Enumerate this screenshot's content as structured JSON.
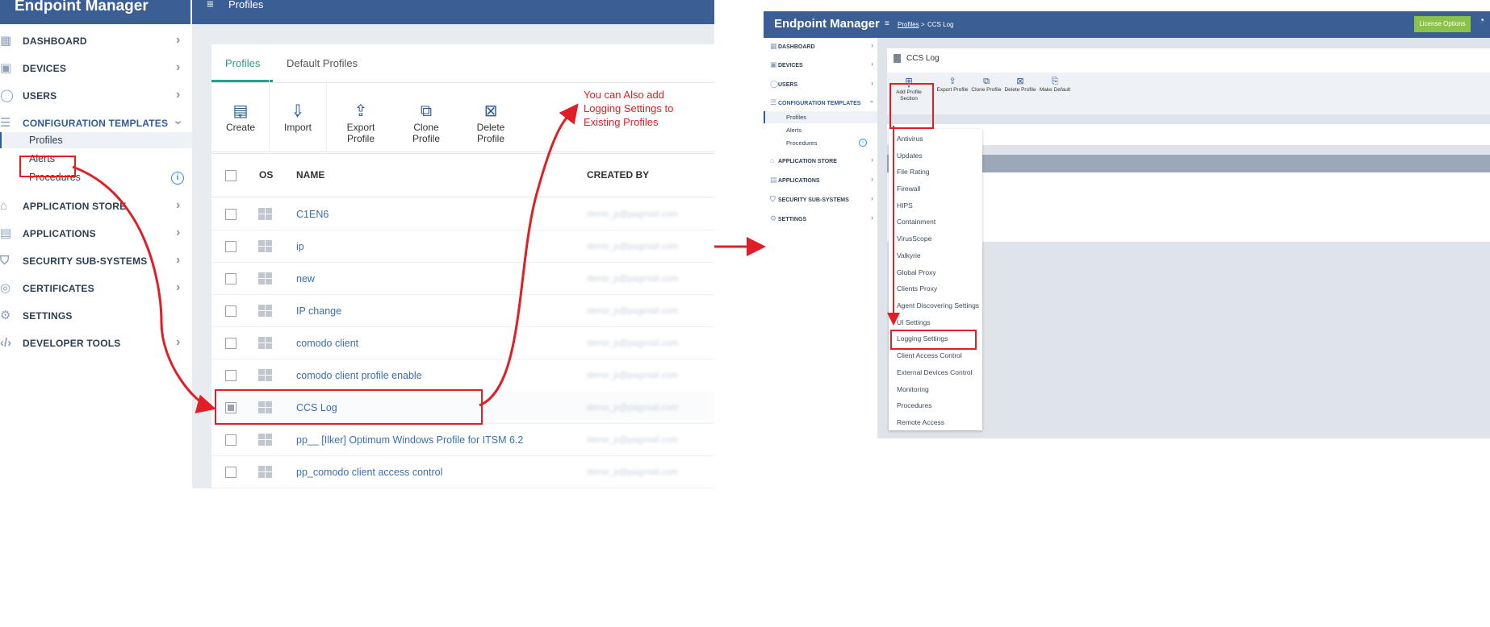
{
  "left": {
    "brand": "Endpoint Manager",
    "topbar_title": "Profiles",
    "sidebar": [
      {
        "label": "DASHBOARD",
        "icon": "dashboard-icon"
      },
      {
        "label": "DEVICES",
        "icon": "devices-icon"
      },
      {
        "label": "USERS",
        "icon": "user-icon"
      },
      {
        "label": "CONFIGURATION TEMPLATES",
        "icon": "templates-icon"
      },
      {
        "label": "APPLICATION STORE",
        "icon": "store-icon"
      },
      {
        "label": "APPLICATIONS",
        "icon": "apps-icon"
      },
      {
        "label": "SECURITY SUB-SYSTEMS",
        "icon": "shield-icon"
      },
      {
        "label": "CERTIFICATES",
        "icon": "certificate-icon"
      },
      {
        "label": "SETTINGS",
        "icon": "gear-icon"
      },
      {
        "label": "DEVELOPER TOOLS",
        "icon": "code-icon"
      }
    ],
    "submenu": [
      "Profiles",
      "Alerts",
      "Procedures"
    ],
    "tabs": [
      "Profiles",
      "Default Profiles"
    ],
    "toolbar": [
      "Create",
      "Import",
      "Export Profile",
      "Clone Profile",
      "Delete Profile"
    ],
    "columns": [
      "OS",
      "NAME",
      "CREATED BY"
    ],
    "rows": [
      {
        "name": "C1EN6",
        "created_by": "demo_p@pagmail.com"
      },
      {
        "name": "ip",
        "created_by": "demo_p@pagmail.com"
      },
      {
        "name": "new",
        "created_by": "demo_p@pagmail.com"
      },
      {
        "name": "IP change",
        "created_by": "demo_p@pagmail.com"
      },
      {
        "name": "comodo client",
        "created_by": "demo_p@pagmail.com"
      },
      {
        "name": "comodo client profile enable",
        "created_by": "demo_p@pagmail.com"
      },
      {
        "name": "CCS Log",
        "created_by": "demo_p@pagmail.com"
      },
      {
        "name": "pp__ [Ilker] Optimum Windows Profile for ITSM 6.2",
        "created_by": "demo_p@pagmail.com"
      },
      {
        "name": "pp_comodo client access control",
        "created_by": "demo_p@pagmail.com"
      }
    ]
  },
  "annotation": "You can Also add Logging Settings to Existing Profiles",
  "right": {
    "brand": "Endpoint Manager",
    "breadcrumb_link": "Profiles",
    "breadcrumb_sep": ">",
    "breadcrumb_current": "CCS Log",
    "license_button": "License Options",
    "sidebar": [
      "DASHBOARD",
      "DEVICES",
      "USERS",
      "CONFIGURATION TEMPLATES",
      "APPLICATION STORE",
      "APPLICATIONS",
      "SECURITY SUB-SYSTEMS",
      "SETTINGS"
    ],
    "submenu": [
      "Profiles",
      "Alerts",
      "Procedures"
    ],
    "profile_title": "CCS Log",
    "toolbar": [
      "Add Profile Section",
      "Export Profile",
      "Clone Profile",
      "Delete Profile",
      "Make Default"
    ],
    "menu": [
      "Antivirus",
      "Updates",
      "File Rating",
      "Firewall",
      "HIPS",
      "Containment",
      "VirusScope",
      "Valkyrie",
      "Global Proxy",
      "Clients Proxy",
      "Agent Discovering Settings",
      "UI Settings",
      "Logging Settings",
      "Client Access Control",
      "External Devices Control",
      "Monitoring",
      "Procedures",
      "Remote Access"
    ]
  },
  "colors": {
    "brand": "#3b5f94",
    "accent": "#2a9d8f",
    "highlight": "#e01e25",
    "license": "#8bc34a"
  }
}
